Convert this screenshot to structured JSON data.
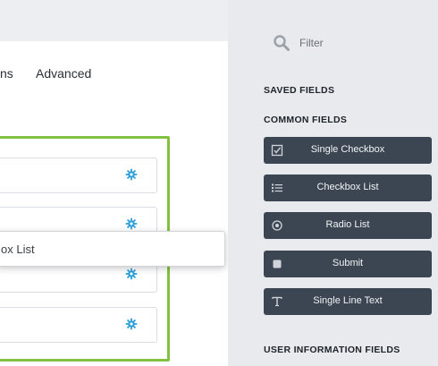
{
  "tabs": [
    {
      "label": "ns"
    },
    {
      "label": "Advanced"
    }
  ],
  "drag_card": {
    "label": "ox List"
  },
  "sidebar": {
    "filter_label": "Filter",
    "saved_heading": "SAVED FIELDS",
    "common_heading": "COMMON FIELDS",
    "user_info_heading": "USER INFORMATION FIELDS",
    "buttons": [
      {
        "label": "Single Checkbox",
        "icon": "checkbox-icon"
      },
      {
        "label": "Checkbox List",
        "icon": "list-icon"
      },
      {
        "label": "Radio List",
        "icon": "radio-icon"
      },
      {
        "label": "Submit",
        "icon": "submit-icon"
      },
      {
        "label": "Single Line Text",
        "icon": "text-icon"
      }
    ]
  },
  "colors": {
    "accent_green": "#83c140",
    "gear_blue": "#2a9ed8",
    "button_bg": "#3c4652"
  }
}
